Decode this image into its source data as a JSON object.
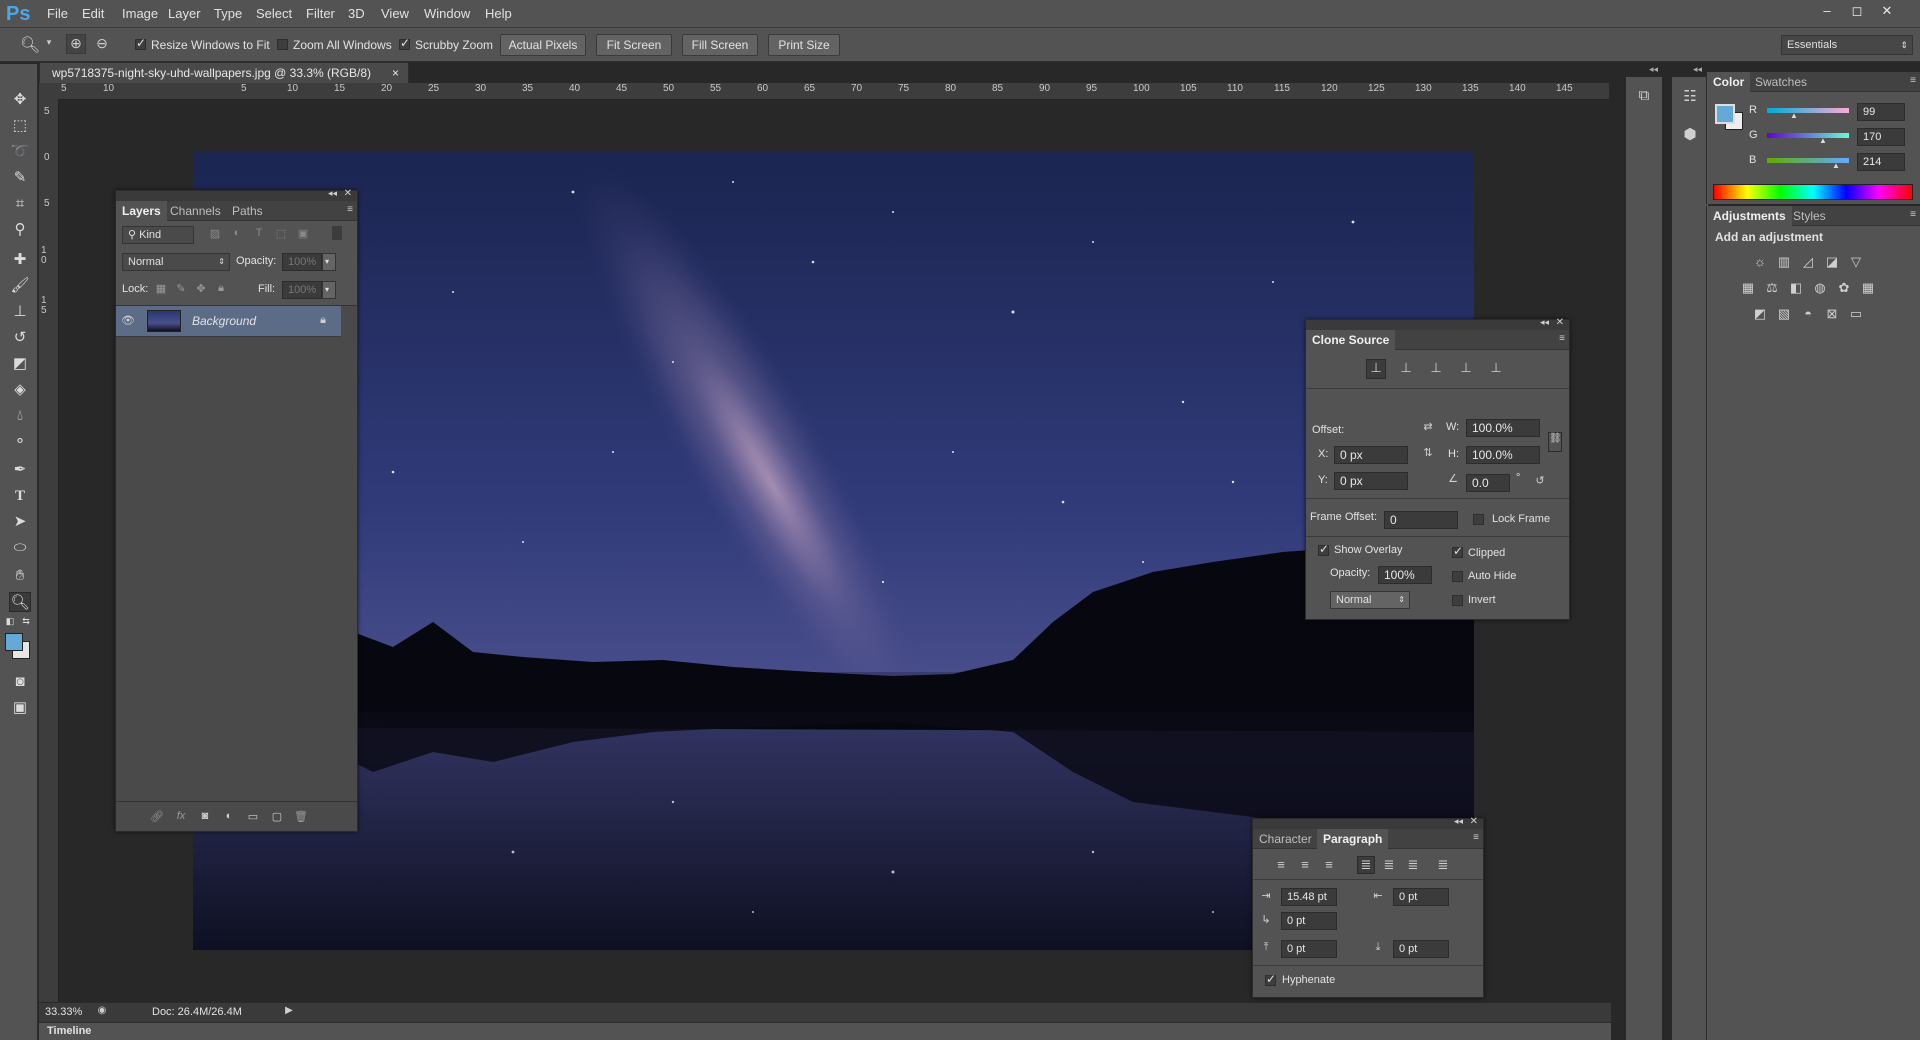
{
  "app": {
    "logo": "Ps"
  },
  "menu": [
    "File",
    "Edit",
    "Image",
    "Layer",
    "Type",
    "Select",
    "Filter",
    "3D",
    "View",
    "Window",
    "Help"
  ],
  "window_controls": [
    "–",
    "◻",
    "✕"
  ],
  "options": {
    "resize_windows": "Resize Windows to Fit",
    "zoom_all": "Zoom All Windows",
    "scrubby": "Scrubby Zoom",
    "actual_pixels": "Actual Pixels",
    "fit_screen": "Fit Screen",
    "fill_screen": "Fill Screen",
    "print_size": "Print Size",
    "workspace": "Essentials"
  },
  "document": {
    "tab_title": "wp5718375-night-sky-uhd-wallpapers.jpg @ 33.3% (RGB/8)",
    "close": "×",
    "ruler_h": [
      "5",
      "10",
      "5",
      "10",
      "15",
      "20",
      "25",
      "30",
      "35",
      "40",
      "45",
      "50",
      "55",
      "60",
      "65",
      "70",
      "75",
      "80",
      "85",
      "90",
      "95",
      "100",
      "105",
      "110",
      "115",
      "120",
      "125",
      "130",
      "135",
      "140",
      "145"
    ],
    "ruler_v": [
      "5",
      "0",
      "5",
      "10",
      "15"
    ]
  },
  "status": {
    "zoom": "33.33%",
    "doc": "Doc: 26.4M/26.4M"
  },
  "timeline": {
    "label": "Timeline"
  },
  "layers": {
    "tabs": [
      "Layers",
      "Channels",
      "Paths"
    ],
    "filter": "Kind",
    "blend": "Normal",
    "opacity_label": "Opacity:",
    "opacity": "100%",
    "lock_label": "Lock:",
    "fill_label": "Fill:",
    "fill": "100%",
    "items": [
      {
        "name": "Background"
      }
    ]
  },
  "clone": {
    "title": "Clone Source",
    "offset_label": "Offset:",
    "w_label": "W:",
    "w": "100.0%",
    "h_label": "H:",
    "h": "100.0%",
    "x_label": "X:",
    "x": "0 px",
    "y_label": "Y:",
    "y": "0 px",
    "angle": "0.0",
    "degree": "°",
    "frame_offset_label": "Frame Offset:",
    "frame_offset": "0",
    "lock_frame": "Lock Frame",
    "show_overlay": "Show Overlay",
    "opacity_label": "Opacity:",
    "opacity": "100%",
    "mode": "Normal",
    "clipped": "Clipped",
    "auto_hide": "Auto Hide",
    "invert": "Invert"
  },
  "paragraph": {
    "tabs": [
      "Character",
      "Paragraph"
    ],
    "indent_left": "15.48 pt",
    "indent_right": "0 pt",
    "indent_first": "0 pt",
    "space_before": "0 pt",
    "space_after": "0 pt",
    "hyphenate": "Hyphenate"
  },
  "color": {
    "tabs": [
      "Color",
      "Swatches"
    ],
    "r_label": "R",
    "r": "99",
    "g_label": "G",
    "g": "170",
    "b_label": "B",
    "b": "214",
    "foreground": "#63aad6"
  },
  "adjustments": {
    "tabs": [
      "Adjustments",
      "Styles"
    ],
    "heading": "Add an adjustment"
  }
}
